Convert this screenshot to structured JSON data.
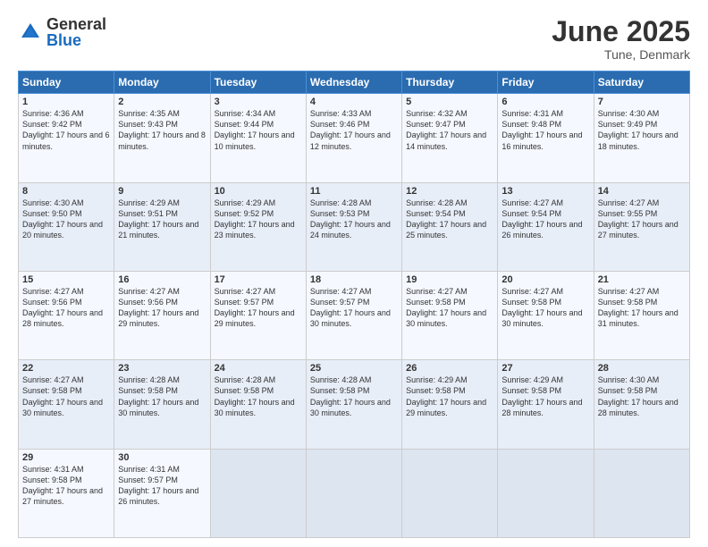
{
  "logo": {
    "general": "General",
    "blue": "Blue"
  },
  "title": "June 2025",
  "location": "Tune, Denmark",
  "days_header": [
    "Sunday",
    "Monday",
    "Tuesday",
    "Wednesday",
    "Thursday",
    "Friday",
    "Saturday"
  ],
  "weeks": [
    [
      {
        "day": "1",
        "sunrise": "Sunrise: 4:36 AM",
        "sunset": "Sunset: 9:42 PM",
        "daylight": "Daylight: 17 hours and 6 minutes."
      },
      {
        "day": "2",
        "sunrise": "Sunrise: 4:35 AM",
        "sunset": "Sunset: 9:43 PM",
        "daylight": "Daylight: 17 hours and 8 minutes."
      },
      {
        "day": "3",
        "sunrise": "Sunrise: 4:34 AM",
        "sunset": "Sunset: 9:44 PM",
        "daylight": "Daylight: 17 hours and 10 minutes."
      },
      {
        "day": "4",
        "sunrise": "Sunrise: 4:33 AM",
        "sunset": "Sunset: 9:46 PM",
        "daylight": "Daylight: 17 hours and 12 minutes."
      },
      {
        "day": "5",
        "sunrise": "Sunrise: 4:32 AM",
        "sunset": "Sunset: 9:47 PM",
        "daylight": "Daylight: 17 hours and 14 minutes."
      },
      {
        "day": "6",
        "sunrise": "Sunrise: 4:31 AM",
        "sunset": "Sunset: 9:48 PM",
        "daylight": "Daylight: 17 hours and 16 minutes."
      },
      {
        "day": "7",
        "sunrise": "Sunrise: 4:30 AM",
        "sunset": "Sunset: 9:49 PM",
        "daylight": "Daylight: 17 hours and 18 minutes."
      }
    ],
    [
      {
        "day": "8",
        "sunrise": "Sunrise: 4:30 AM",
        "sunset": "Sunset: 9:50 PM",
        "daylight": "Daylight: 17 hours and 20 minutes."
      },
      {
        "day": "9",
        "sunrise": "Sunrise: 4:29 AM",
        "sunset": "Sunset: 9:51 PM",
        "daylight": "Daylight: 17 hours and 21 minutes."
      },
      {
        "day": "10",
        "sunrise": "Sunrise: 4:29 AM",
        "sunset": "Sunset: 9:52 PM",
        "daylight": "Daylight: 17 hours and 23 minutes."
      },
      {
        "day": "11",
        "sunrise": "Sunrise: 4:28 AM",
        "sunset": "Sunset: 9:53 PM",
        "daylight": "Daylight: 17 hours and 24 minutes."
      },
      {
        "day": "12",
        "sunrise": "Sunrise: 4:28 AM",
        "sunset": "Sunset: 9:54 PM",
        "daylight": "Daylight: 17 hours and 25 minutes."
      },
      {
        "day": "13",
        "sunrise": "Sunrise: 4:27 AM",
        "sunset": "Sunset: 9:54 PM",
        "daylight": "Daylight: 17 hours and 26 minutes."
      },
      {
        "day": "14",
        "sunrise": "Sunrise: 4:27 AM",
        "sunset": "Sunset: 9:55 PM",
        "daylight": "Daylight: 17 hours and 27 minutes."
      }
    ],
    [
      {
        "day": "15",
        "sunrise": "Sunrise: 4:27 AM",
        "sunset": "Sunset: 9:56 PM",
        "daylight": "Daylight: 17 hours and 28 minutes."
      },
      {
        "day": "16",
        "sunrise": "Sunrise: 4:27 AM",
        "sunset": "Sunset: 9:56 PM",
        "daylight": "Daylight: 17 hours and 29 minutes."
      },
      {
        "day": "17",
        "sunrise": "Sunrise: 4:27 AM",
        "sunset": "Sunset: 9:57 PM",
        "daylight": "Daylight: 17 hours and 29 minutes."
      },
      {
        "day": "18",
        "sunrise": "Sunrise: 4:27 AM",
        "sunset": "Sunset: 9:57 PM",
        "daylight": "Daylight: 17 hours and 30 minutes."
      },
      {
        "day": "19",
        "sunrise": "Sunrise: 4:27 AM",
        "sunset": "Sunset: 9:58 PM",
        "daylight": "Daylight: 17 hours and 30 minutes."
      },
      {
        "day": "20",
        "sunrise": "Sunrise: 4:27 AM",
        "sunset": "Sunset: 9:58 PM",
        "daylight": "Daylight: 17 hours and 30 minutes."
      },
      {
        "day": "21",
        "sunrise": "Sunrise: 4:27 AM",
        "sunset": "Sunset: 9:58 PM",
        "daylight": "Daylight: 17 hours and 31 minutes."
      }
    ],
    [
      {
        "day": "22",
        "sunrise": "Sunrise: 4:27 AM",
        "sunset": "Sunset: 9:58 PM",
        "daylight": "Daylight: 17 hours and 30 minutes."
      },
      {
        "day": "23",
        "sunrise": "Sunrise: 4:28 AM",
        "sunset": "Sunset: 9:58 PM",
        "daylight": "Daylight: 17 hours and 30 minutes."
      },
      {
        "day": "24",
        "sunrise": "Sunrise: 4:28 AM",
        "sunset": "Sunset: 9:58 PM",
        "daylight": "Daylight: 17 hours and 30 minutes."
      },
      {
        "day": "25",
        "sunrise": "Sunrise: 4:28 AM",
        "sunset": "Sunset: 9:58 PM",
        "daylight": "Daylight: 17 hours and 30 minutes."
      },
      {
        "day": "26",
        "sunrise": "Sunrise: 4:29 AM",
        "sunset": "Sunset: 9:58 PM",
        "daylight": "Daylight: 17 hours and 29 minutes."
      },
      {
        "day": "27",
        "sunrise": "Sunrise: 4:29 AM",
        "sunset": "Sunset: 9:58 PM",
        "daylight": "Daylight: 17 hours and 28 minutes."
      },
      {
        "day": "28",
        "sunrise": "Sunrise: 4:30 AM",
        "sunset": "Sunset: 9:58 PM",
        "daylight": "Daylight: 17 hours and 28 minutes."
      }
    ],
    [
      {
        "day": "29",
        "sunrise": "Sunrise: 4:31 AM",
        "sunset": "Sunset: 9:58 PM",
        "daylight": "Daylight: 17 hours and 27 minutes."
      },
      {
        "day": "30",
        "sunrise": "Sunrise: 4:31 AM",
        "sunset": "Sunset: 9:57 PM",
        "daylight": "Daylight: 17 hours and 26 minutes."
      },
      null,
      null,
      null,
      null,
      null
    ]
  ]
}
